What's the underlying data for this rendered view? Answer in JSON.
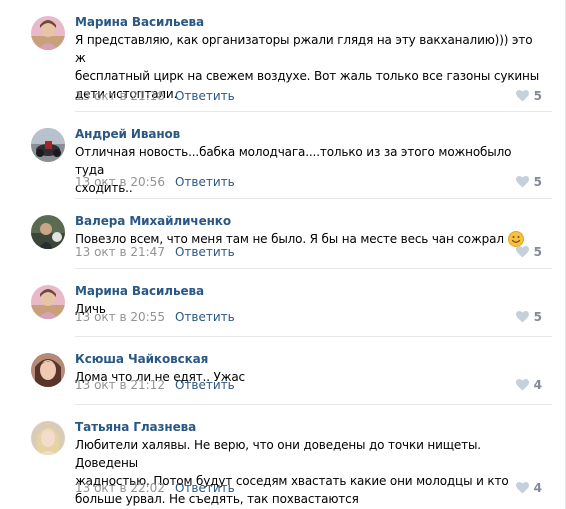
{
  "comments": [
    {
      "author": "Марина Васильева",
      "text": "Я представляю, как организаторы ржали глядя на эту вакханалию))) это ж\nбесплатный цирк на свежем воздухе. Вот жаль только все газоны сукины\nдети истоптали.",
      "date": "13 окт в 21:18",
      "reply": "Ответить",
      "likes": "5",
      "avatar": "avatar-marina"
    },
    {
      "author": "Андрей Иванов",
      "text": "Отличная новость...бабка молодчага....только из за этого можнобыло туда\nсходить..",
      "date": "13 окт в 20:56",
      "reply": "Ответить",
      "likes": "5",
      "avatar": "avatar-andrey"
    },
    {
      "author": "Валера Михайличенко",
      "text": "Повезло всем, что меня там не было. Я бы на месте весь чан сожрал",
      "emoji": "smiling-face-emoji",
      "date": "13 окт в 21:47",
      "reply": "Ответить",
      "likes": "5",
      "avatar": "avatar-valera"
    },
    {
      "author": "Марина Васильева",
      "text": "Дичь",
      "date": "13 окт в 20:55",
      "reply": "Ответить",
      "likes": "5",
      "avatar": "avatar-marina"
    },
    {
      "author": "Ксюша Чайковская",
      "text": "Дома что ли не едят.. Ужас",
      "date": "13 окт в 21:12",
      "reply": "Ответить",
      "likes": "4",
      "avatar": "avatar-ksyusha"
    },
    {
      "author": "Татьяна Глазнева",
      "text": "Любители халявы. Не верю, что они доведены до точки нищеты. Доведены\nжадностью. Потом будут соседям хвастать какие они молодцы и кто\nбольше урвал. Не съедять, так похвастаются",
      "date": "13 окт в 22:02",
      "reply": "Ответить",
      "likes": "4",
      "avatar": "avatar-tatyana"
    }
  ],
  "icons": {
    "like": "heart-icon"
  },
  "colors": {
    "author_link": "#2a5885",
    "date": "#939393",
    "likes": "#828a99",
    "divider": "#e7e8ec"
  }
}
